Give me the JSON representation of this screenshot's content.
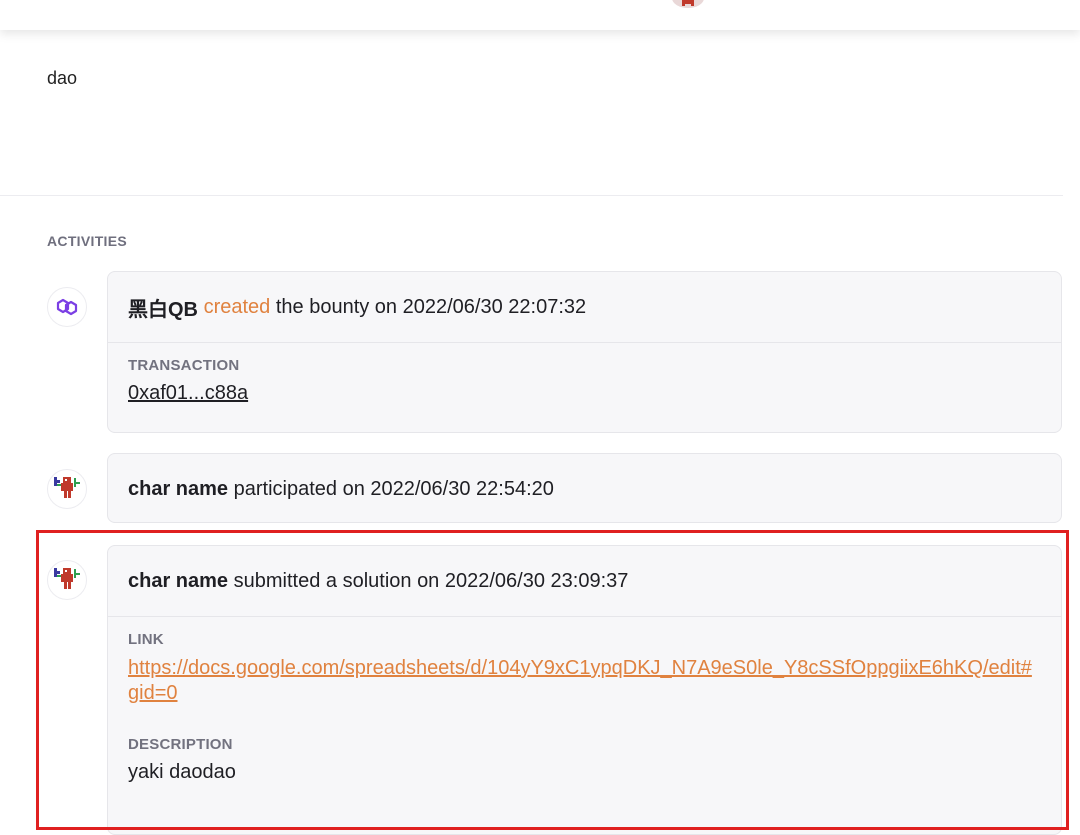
{
  "section": {
    "title": "dao"
  },
  "activities": {
    "heading": "ACTIVITIES",
    "created": {
      "user": "黑白QB",
      "action": "created",
      "rest": "the bounty on 2022/06/30 22:07:32",
      "transaction_label": "TRANSACTION",
      "transaction_hash": "0xaf01...c88a"
    },
    "participated": {
      "user": "char name",
      "rest": "participated on 2022/06/30 22:54:20"
    },
    "submitted": {
      "user": "char name",
      "rest": "submitted a solution on 2022/06/30 23:09:37",
      "link_label": "LINK",
      "link_url": "https://docs.google.com/spreadsheets/d/104yY9xC1ypqDKJ_N7A9eS0le_Y8cSSfOppgiixE6hKQ/edit#gid=0",
      "description_label": "DESCRIPTION",
      "description_value": "yaki daodao"
    }
  },
  "icons": {
    "polygon": "polygon-logo-icon",
    "avatar": "pixel-character-avatar"
  },
  "colors": {
    "accent": "#e0823f",
    "highlight_border": "#e02020",
    "polygon_purple": "#7b3fe4"
  }
}
